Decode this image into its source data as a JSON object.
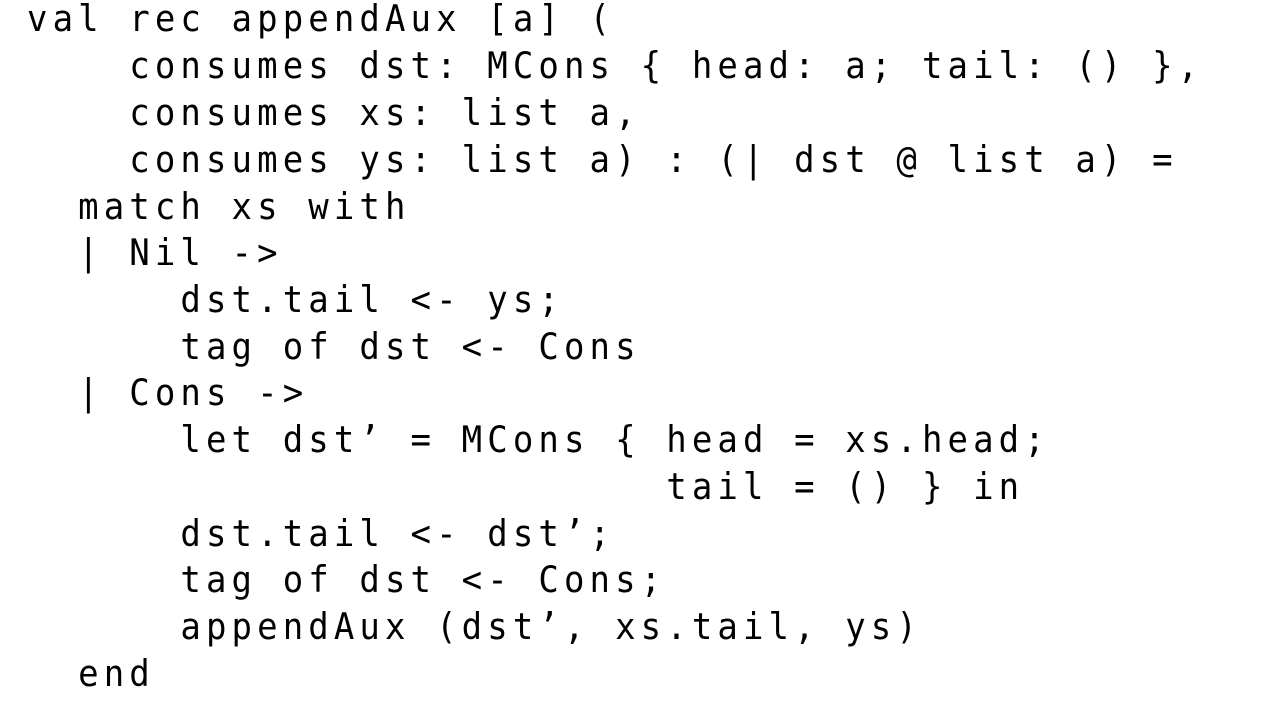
{
  "code": {
    "lines": [
      "val rec appendAux [a] (",
      "    consumes dst: MCons { head: a; tail: () },",
      "    consumes xs: list a,",
      "    consumes ys: list a) : (| dst @ list a) =",
      "  match xs with",
      "  | Nil ->",
      "      dst.tail <- ys;",
      "      tag of dst <- Cons",
      "  | Cons ->",
      "      let dst’ = MCons { head = xs.head;",
      "                         tail = () } in",
      "      dst.tail <- dst’;",
      "      tag of dst <- Cons;",
      "      appendAux (dst’, xs.tail, ys)",
      "  end"
    ]
  }
}
